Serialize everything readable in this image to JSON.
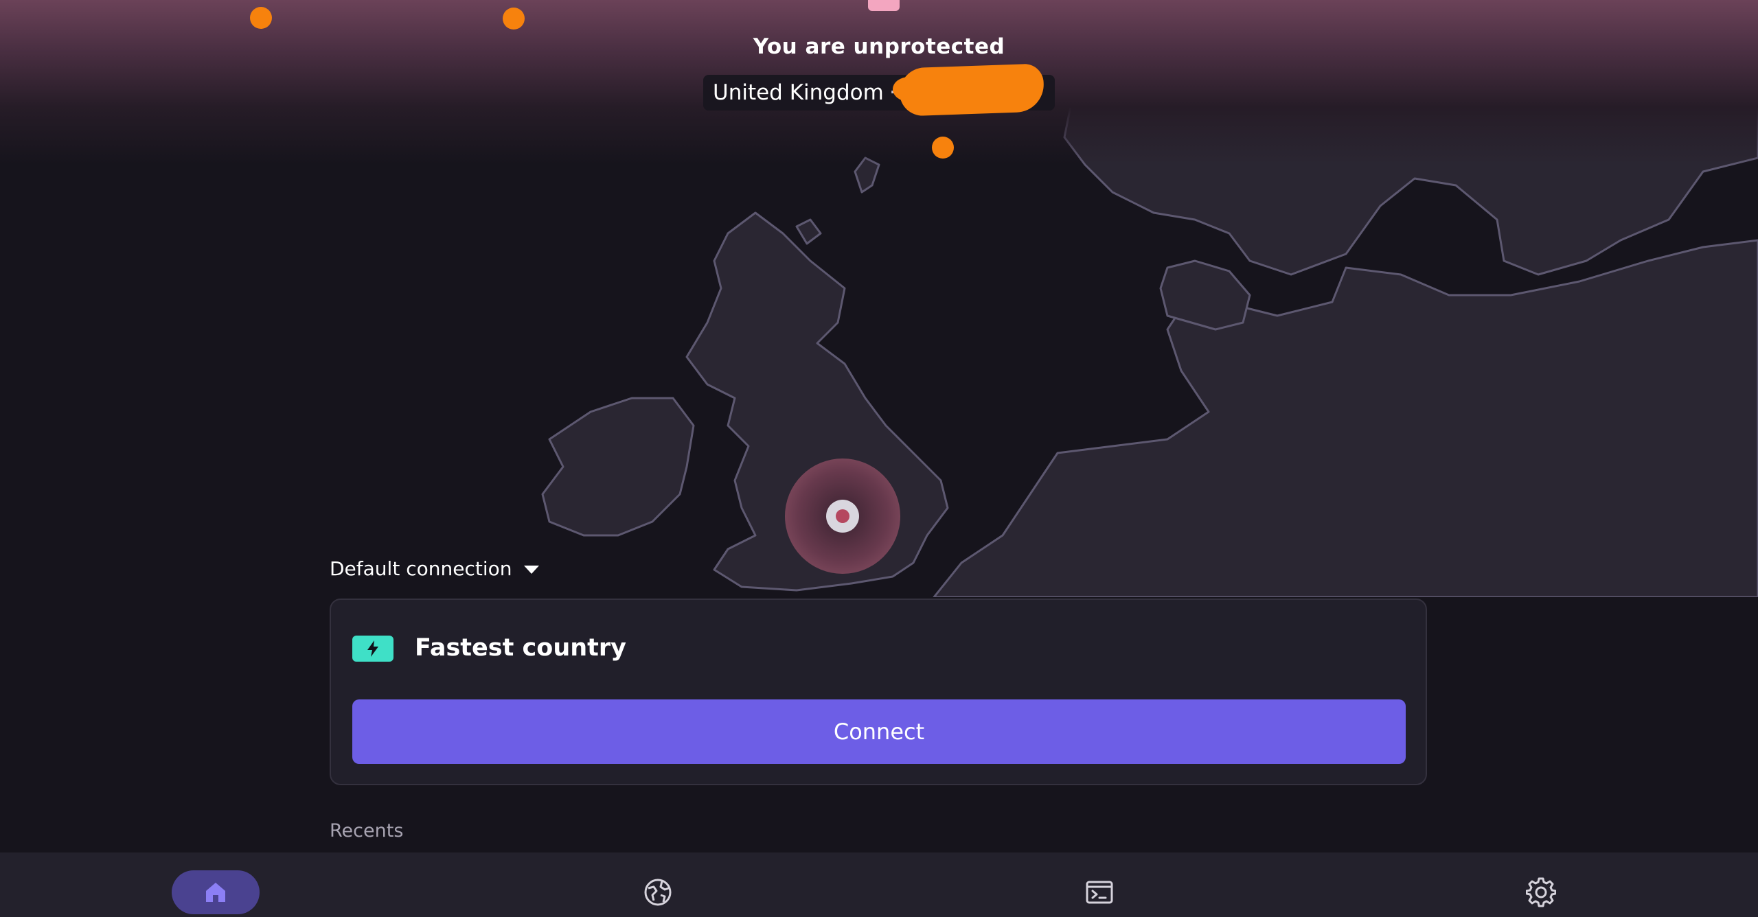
{
  "status": {
    "title": "You are unprotected",
    "country": "United Kingdom",
    "separator": "·"
  },
  "connection": {
    "default_label": "Default connection",
    "profile_name": "Fastest country",
    "connect_label": "Connect"
  },
  "recents_label": "Recents",
  "nav": {
    "items": [
      {
        "icon": "home-icon",
        "active": true
      },
      {
        "icon": "globe-icon",
        "active": false
      },
      {
        "icon": "terminal-icon",
        "active": false
      },
      {
        "icon": "gear-icon",
        "active": false
      }
    ]
  },
  "colors": {
    "accent": "#6d5ee6",
    "bolt_badge": "#3fe0c7",
    "server_marker": "#f7820d",
    "background": "#16141c"
  }
}
